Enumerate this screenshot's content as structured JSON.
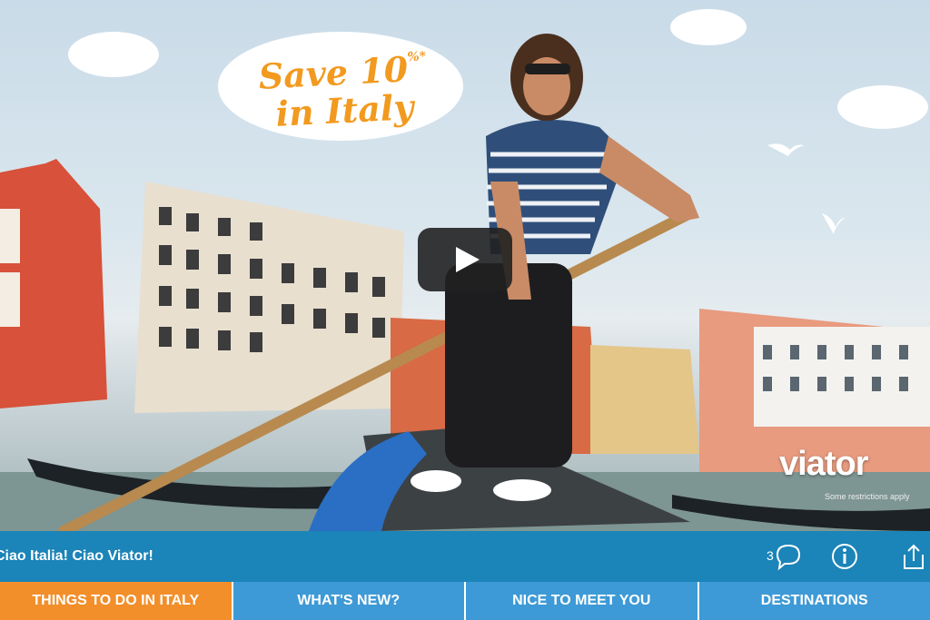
{
  "video": {
    "promo_line1": "Save 10",
    "promo_sup": "%*",
    "promo_line2": "in Italy",
    "brand": "viator",
    "brand_note": "Some restrictions apply"
  },
  "caption_bar": {
    "caption": "Ciao Italia! Ciao Viator!",
    "comment_count": "3"
  },
  "nav": {
    "tabs": [
      {
        "label": "THINGS TO DO IN ITALY",
        "active": true
      },
      {
        "label": "WHAT'S NEW?",
        "active": false
      },
      {
        "label": "NICE TO MEET YOU",
        "active": false
      },
      {
        "label": "DESTINATIONS",
        "active": false
      }
    ]
  },
  "colors": {
    "caption_bar": "#1b84b8",
    "tab": "#3d9ad6",
    "tab_active": "#f28f2a",
    "promo": "#f29a1f"
  },
  "icons": [
    "play-icon",
    "comment-icon",
    "info-icon",
    "share-icon"
  ]
}
